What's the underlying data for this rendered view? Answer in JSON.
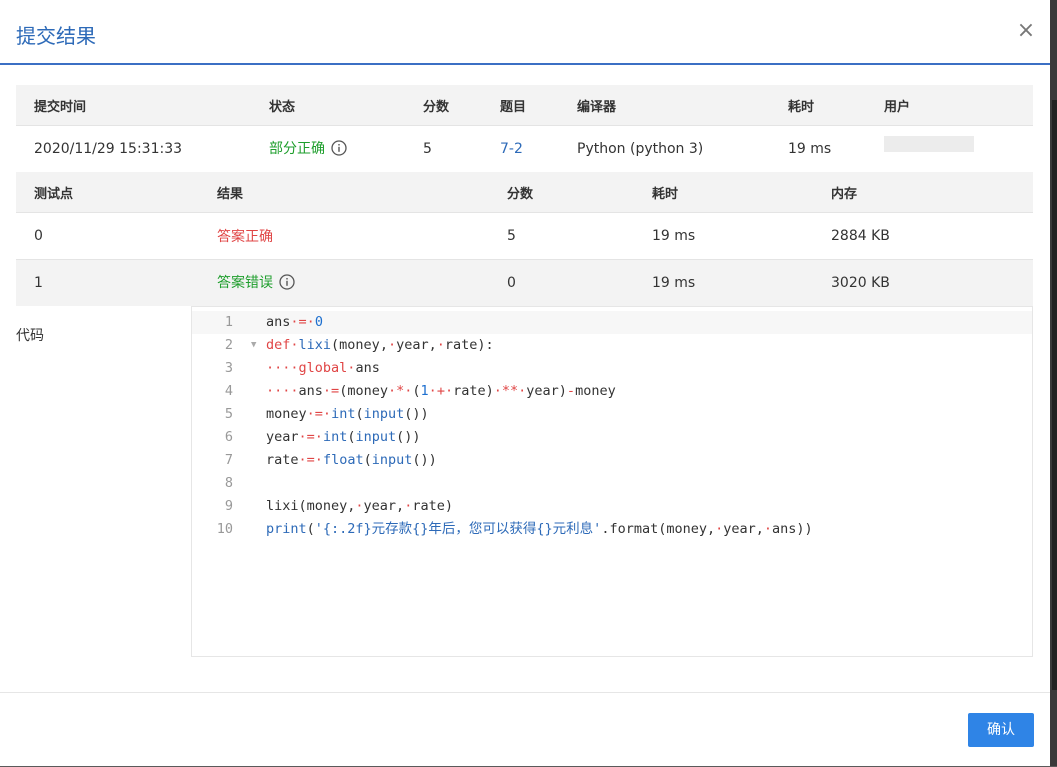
{
  "modal": {
    "title": "提交结果",
    "close": "×",
    "confirm_label": "确认"
  },
  "submission": {
    "headers": [
      "提交时间",
      "状态",
      "分数",
      "题目",
      "编译器",
      "耗时",
      "用户"
    ],
    "row": {
      "time": "2020/11/29 15:31:33",
      "status": "部分正确",
      "score": "5",
      "problem": "7-2",
      "compiler": "Python (python 3)",
      "duration": "19 ms"
    }
  },
  "testcases": {
    "headers": [
      "测试点",
      "结果",
      "分数",
      "耗时",
      "内存"
    ],
    "rows": [
      {
        "id": "0",
        "result": "答案正确",
        "score": "5",
        "duration": "19 ms",
        "memory": "2884 KB"
      },
      {
        "id": "1",
        "result": "答案错误",
        "score": "0",
        "duration": "19 ms",
        "memory": "3020 KB"
      }
    ]
  },
  "code": {
    "label": "代码",
    "lines": [
      {
        "n": "1"
      },
      {
        "n": "2"
      },
      {
        "n": "3"
      },
      {
        "n": "4"
      },
      {
        "n": "5"
      },
      {
        "n": "6"
      },
      {
        "n": "7"
      },
      {
        "n": "8"
      },
      {
        "n": "9"
      },
      {
        "n": "10"
      }
    ]
  },
  "colors": {
    "title": "#2d6ab8",
    "partial_correct": "#1e9e2c",
    "correct": "#e04545",
    "wrong": "#1e9e2c",
    "confirm_button": "#2f84e6"
  }
}
